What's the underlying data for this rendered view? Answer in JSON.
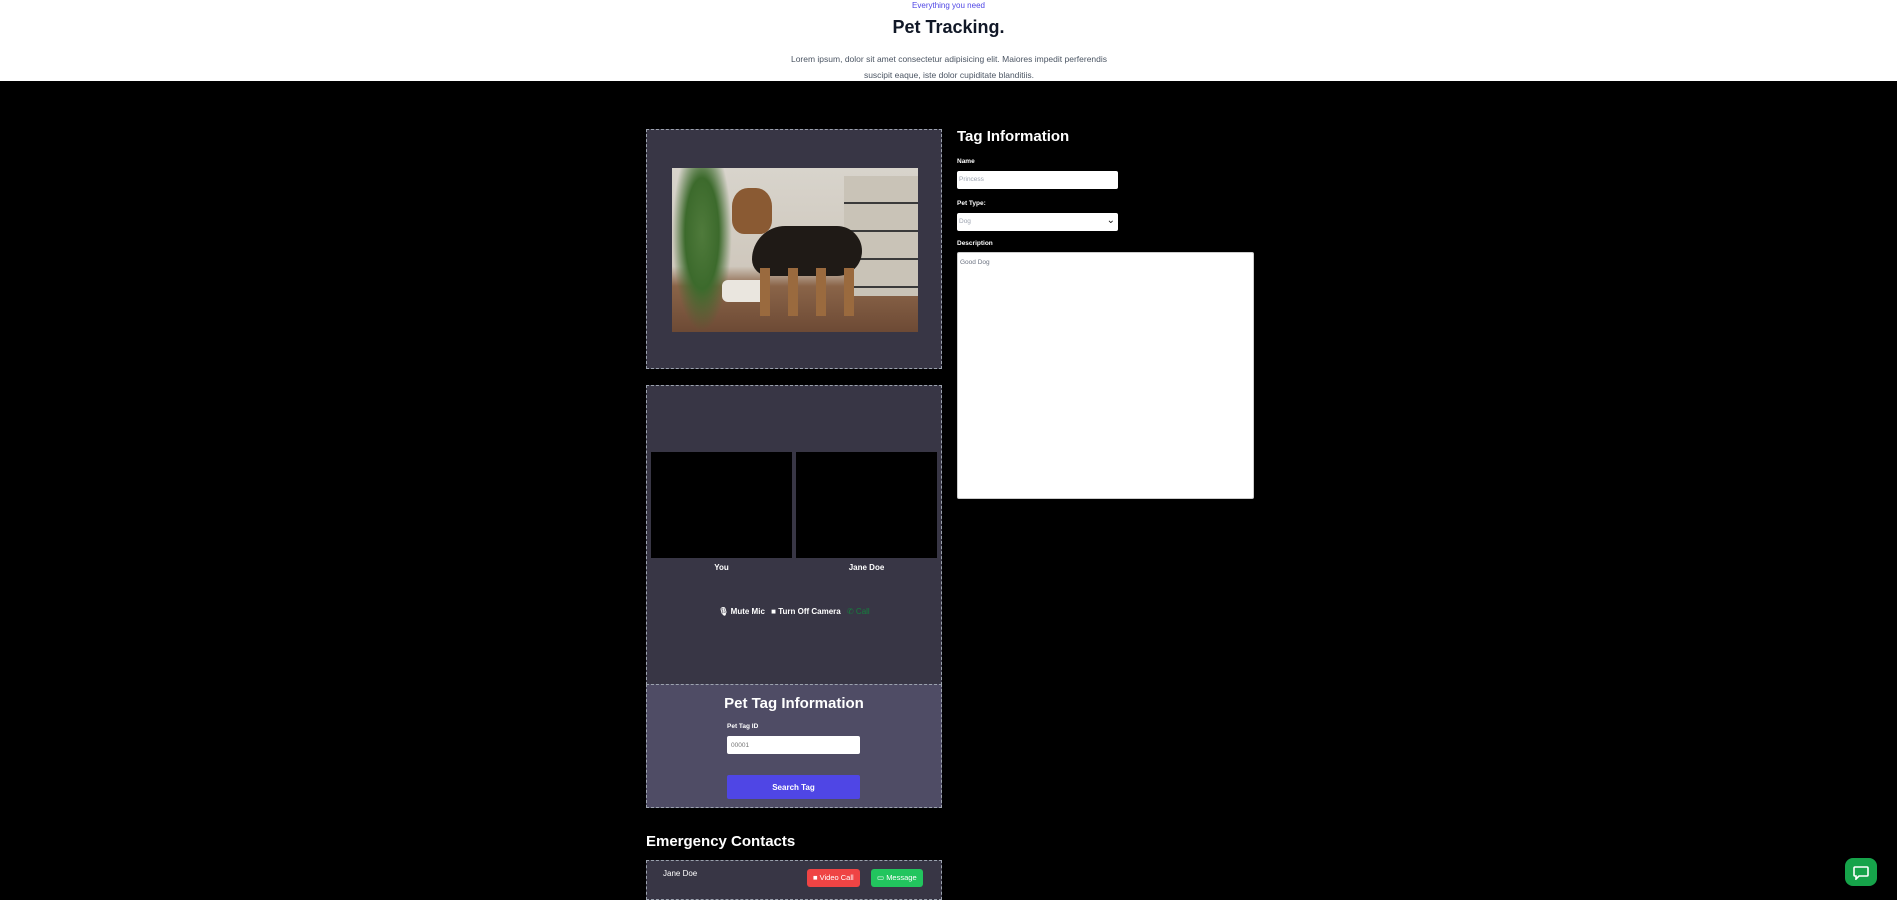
{
  "hero": {
    "eyebrow": "Everything you need",
    "title": "Pet Tracking.",
    "subtitle": "Lorem ipsum, dolor sit amet consectetur adipisicing elit. Maiores impedit perferendis suscipit eaque, iste dolor cupiditate blanditiis."
  },
  "video": {
    "you_label": "You",
    "peer_label": "Jane Doe",
    "controls": {
      "mute": "Mute Mic",
      "camera": "Turn Off Camera",
      "call": "Call"
    }
  },
  "pet_tag_search": {
    "heading": "Pet Tag Information",
    "id_label": "Pet Tag ID",
    "id_placeholder": "00001",
    "button": "Search Tag"
  },
  "emergency": {
    "heading": "Emergency Contacts",
    "contacts": [
      {
        "name": "Jane Doe",
        "video_call": "Video Call",
        "message": "Message"
      }
    ]
  },
  "tag_info": {
    "heading": "Tag Information",
    "name_label": "Name",
    "name_value": "Princess",
    "type_label": "Pet Type:",
    "type_value": "Dog",
    "desc_label": "Description",
    "desc_value": "Good Dog"
  },
  "colors": {
    "accent": "#4f46e5",
    "panel": "#383645",
    "video_call": "#ef4444",
    "message": "#22c55e"
  }
}
